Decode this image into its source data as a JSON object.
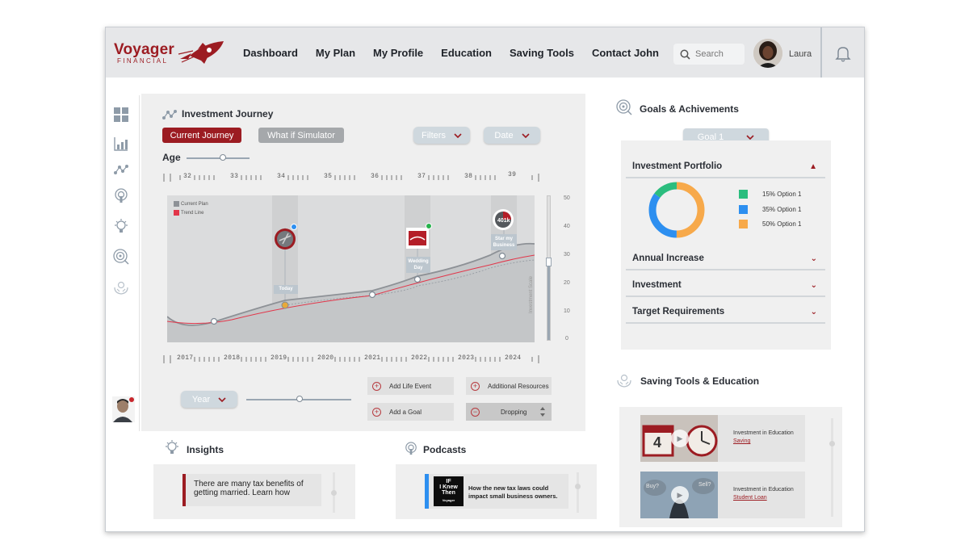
{
  "brand": {
    "name": "Voyager",
    "sub": "FINANCIAL"
  },
  "nav": [
    "Dashboard",
    "My Plan",
    "My Profile",
    "Education",
    "Saving Tools",
    "Contact John"
  ],
  "search": {
    "placeholder": "Search"
  },
  "user": {
    "name": "Laura"
  },
  "colors": {
    "accent": "#9c1c22",
    "pill": "#cfd8de",
    "donut_green": "#2bbd7e",
    "donut_blue": "#2d8ff0",
    "donut_orange": "#f7a94a"
  },
  "sidebar_icons": [
    "dashboard-icon",
    "bar-chart-icon",
    "journey-icon",
    "podcast-icon",
    "insight-bulb-icon",
    "goal-target-icon",
    "saving-hands-icon"
  ],
  "journey": {
    "title": "Investment Journey",
    "current_btn": "Current Journey",
    "whatif_btn": "What if Simulator",
    "filters": "Filters",
    "date": "Date",
    "age_label": "Age",
    "age_ticks": [
      "32",
      "33",
      "34",
      "35",
      "36",
      "37",
      "38",
      "39"
    ],
    "year_ticks": [
      "2017",
      "2018",
      "2019",
      "2020",
      "2021",
      "2022",
      "2023",
      "2024"
    ],
    "legend": [
      "Current Plan",
      "Trend Line"
    ],
    "events": [
      "Today",
      "Wedding Day",
      "Star my Business"
    ],
    "scale_title": "Investment Scale",
    "scale_values": [
      "50",
      "40",
      "30",
      "20",
      "10",
      "0"
    ],
    "year_btn": "Year",
    "actions": {
      "add_life_event": "Add Life Event",
      "additional_resources": "Additional Resources",
      "add_goal": "Add a Goal",
      "dropping": "Dropping"
    }
  },
  "insights": {
    "title": "Insights",
    "text_line1": "There are many tax benefits of",
    "text_line2": "getting married. Learn how"
  },
  "podcasts": {
    "title": "Podcasts",
    "thumb_text": [
      "IF",
      "I Knew",
      "Then",
      "Voyager"
    ],
    "text_line1": "How the new tax laws could",
    "text_line2": "impact small business owners."
  },
  "goals": {
    "title": "Goals & Achivements",
    "goal_select": "Goal 1",
    "portfolio_title": "Investment Portfolio",
    "legend": [
      "15% Option 1",
      "35% Option 1",
      "50% Option 1"
    ],
    "accordion": [
      "Annual Increase",
      "Investment",
      "Target Requirements"
    ]
  },
  "saving": {
    "title": "Saving Tools & Education",
    "videos": [
      {
        "title": "Investment in Education",
        "link": "Saving",
        "thumb": "4"
      },
      {
        "title": "Investment in Education",
        "link": "Student Loan",
        "thumb_a": "Buy?",
        "thumb_b": "Sell?"
      }
    ]
  }
}
